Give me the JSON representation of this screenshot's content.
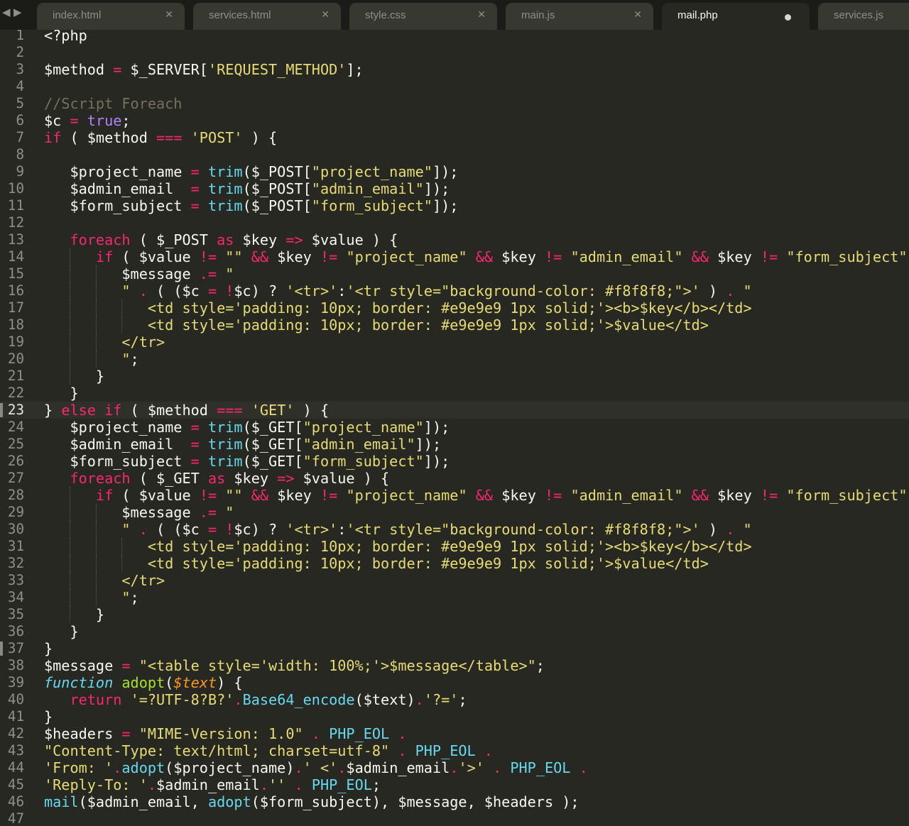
{
  "tabs": [
    {
      "label": "index.html",
      "active": false,
      "dirty": false
    },
    {
      "label": "services.html",
      "active": false,
      "dirty": false
    },
    {
      "label": "style.css",
      "active": false,
      "dirty": false
    },
    {
      "label": "main.js",
      "active": false,
      "dirty": false
    },
    {
      "label": "mail.php",
      "active": true,
      "dirty": true
    },
    {
      "label": "services.js",
      "active": false,
      "dirty": false
    }
  ],
  "nav": {
    "back_icon": "◀",
    "forward_icon": "▶"
  },
  "close_icon": "✕",
  "colors": {
    "background": "#272822",
    "string": "#e6db74",
    "keyword": "#f92672",
    "builtin": "#66d9ef",
    "comment": "#75715e",
    "constant": "#ae81ff",
    "function_name": "#a6e22e",
    "argument": "#fd971f"
  },
  "editor": {
    "current_line": 23,
    "lines": [
      "<?php",
      "",
      "$method = $_SERVER['REQUEST_METHOD'];",
      "",
      "//Script Foreach",
      "$c = true;",
      "if ( $method === 'POST' ) {",
      "",
      "   $project_name = trim($_POST[\"project_name\"]);",
      "   $admin_email  = trim($_POST[\"admin_email\"]);",
      "   $form_subject = trim($_POST[\"form_subject\"]);",
      "",
      "   foreach ( $_POST as $key => $value ) {",
      "      if ( $value != \"\" && $key != \"project_name\" && $key != \"admin_email\" && $key != \"form_subject\" ) {",
      "         $message .= \"",
      "         \" . ( ($c = !$c) ? '<tr>':'<tr style=\"background-color: #f8f8f8;\">' ) . \"",
      "            <td style='padding: 10px; border: #e9e9e9 1px solid;'><b>$key</b></td>",
      "            <td style='padding: 10px; border: #e9e9e9 1px solid;'>$value</td>",
      "         </tr>",
      "         \";",
      "      }",
      "   }",
      "} else if ( $method === 'GET' ) {",
      "   $project_name = trim($_GET[\"project_name\"]);",
      "   $admin_email  = trim($_GET[\"admin_email\"]);",
      "   $form_subject = trim($_GET[\"form_subject\"]);",
      "   foreach ( $_GET as $key => $value ) {",
      "      if ( $value != \"\" && $key != \"project_name\" && $key != \"admin_email\" && $key != \"form_subject\" ) {",
      "         $message .= \"",
      "         \" . ( ($c = !$c) ? '<tr>':'<tr style=\"background-color: #f8f8f8;\">' ) . \"",
      "            <td style='padding: 10px; border: #e9e9e9 1px solid;'><b>$key</b></td>",
      "            <td style='padding: 10px; border: #e9e9e9 1px solid;'>$value</td>",
      "         </tr>",
      "         \";",
      "      }",
      "   }",
      "}",
      "$message = \"<table style='width: 100%;'>$message</table>\";",
      "function adopt($text) {",
      "   return '=?UTF-8?B?'.Base64_encode($text).'?=';",
      "}",
      "$headers = \"MIME-Version: 1.0\" . PHP_EOL .",
      "\"Content-Type: text/html; charset=utf-8\" . PHP_EOL .",
      "'From: '.adopt($project_name).' <'.$admin_email.'>' . PHP_EOL .",
      "'Reply-To: '.$admin_email.'' . PHP_EOL;",
      "mail($admin_email, adopt($form_subject), $message, $headers );",
      ""
    ]
  }
}
